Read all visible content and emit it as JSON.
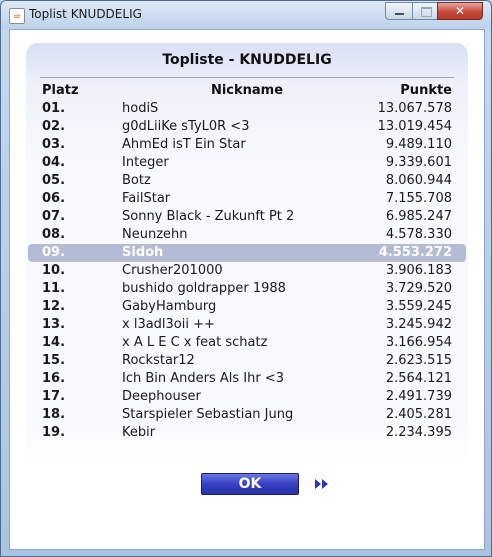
{
  "window": {
    "title": "Toplist KNUDDELIG",
    "app_icon": "java-cup-icon",
    "close_glyph": "✕"
  },
  "panel": {
    "title": "Topliste - KNUDDELIG",
    "columns": {
      "rank": "Platz",
      "nickname": "Nickname",
      "points": "Punkte"
    }
  },
  "rows": [
    {
      "rank": "01.",
      "nickname": "hodiS",
      "points": "13.067.578"
    },
    {
      "rank": "02.",
      "nickname": "g0dLiiKe sTyL0R <3",
      "points": "13.019.454"
    },
    {
      "rank": "03.",
      "nickname": "AhmEd isT Ein Star",
      "points": "9.489.110"
    },
    {
      "rank": "04.",
      "nickname": "Integer",
      "points": "9.339.601"
    },
    {
      "rank": "05.",
      "nickname": "Botz",
      "points": "8.060.944"
    },
    {
      "rank": "06.",
      "nickname": "FailStar",
      "points": "7.155.708"
    },
    {
      "rank": "07.",
      "nickname": "Sonny Black - Zukunft Pt 2",
      "points": "6.985.247"
    },
    {
      "rank": "08.",
      "nickname": "Neunzehn",
      "points": "4.578.330"
    },
    {
      "rank": "09.",
      "nickname": "Sidoh",
      "points": "4.553.272",
      "highlighted": true
    },
    {
      "rank": "10.",
      "nickname": "Crusher201000",
      "points": "3.906.183"
    },
    {
      "rank": "11.",
      "nickname": "bushido goldrapper 1988",
      "points": "3.729.520"
    },
    {
      "rank": "12.",
      "nickname": "GabyHamburg",
      "points": "3.559.245"
    },
    {
      "rank": "13.",
      "nickname": "x l3adl3oii ++",
      "points": "3.245.942"
    },
    {
      "rank": "14.",
      "nickname": "x A L E C x feat schatz",
      "points": "3.166.954"
    },
    {
      "rank": "15.",
      "nickname": "Rockstar12",
      "points": "2.623.515"
    },
    {
      "rank": "16.",
      "nickname": "Ich Bin Anders Als Ihr <3",
      "points": "2.564.121"
    },
    {
      "rank": "17.",
      "nickname": "Deephouser",
      "points": "2.491.739"
    },
    {
      "rank": "18.",
      "nickname": "Starspieler Sebastian Jung",
      "points": "2.405.281"
    },
    {
      "rank": "19.",
      "nickname": "Kebir",
      "points": "2.234.395"
    }
  ],
  "buttons": {
    "ok_label": "OK",
    "next_icon": "double-chevron-right-icon"
  },
  "colors": {
    "highlight_row": "#b4bbd4",
    "ok_button": "#3640c0",
    "arrow": "#2a35b8"
  }
}
